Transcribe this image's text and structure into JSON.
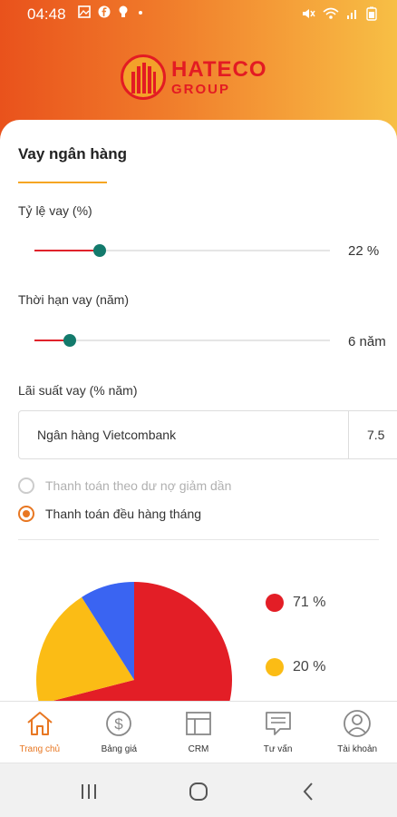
{
  "status_bar": {
    "time": "04:48",
    "left_icons": [
      "gallery-icon",
      "facebook-icon",
      "bulb-icon",
      "dot-icon"
    ],
    "right_icons": [
      "mute-icon",
      "wifi-icon",
      "signal-icon",
      "battery-icon"
    ]
  },
  "brand": {
    "name_line1": "HATECO",
    "name_line2": "GROUP",
    "color": "#e31b23"
  },
  "form": {
    "title": "Vay ngân hàng",
    "loan_ratio": {
      "label": "Tỷ lệ vay (%)",
      "value": "22 %",
      "level_fraction": 0.22
    },
    "loan_term": {
      "label": "Thời hạn vay (năm)",
      "value": "6 năm",
      "level_fraction": 0.12
    },
    "interest": {
      "label": "Lãi suất vay (% năm)",
      "bank_select": "Ngân hàng Vietcombank",
      "rate_value": "7.5"
    },
    "payment_options": [
      {
        "label": "Thanh toán theo dư nợ giảm dần",
        "selected": false
      },
      {
        "label": "Thanh toán đều hàng tháng",
        "selected": true
      }
    ]
  },
  "pie_chart": {
    "slices": [
      {
        "label": "71 %",
        "percent": 71,
        "color": "#e31e26"
      },
      {
        "label": "20 %",
        "percent": 20,
        "color": "#fbbc15"
      },
      {
        "label": "9 %",
        "percent": 9,
        "color": "#3a64f2"
      }
    ],
    "visible_legend": [
      "71 %",
      "20 %"
    ]
  },
  "bottom_nav": [
    {
      "label": "Trang chủ",
      "icon": "home-icon",
      "active": true
    },
    {
      "label": "Bảng giá",
      "icon": "dollar-icon",
      "active": false
    },
    {
      "label": "CRM",
      "icon": "crm-icon",
      "active": false
    },
    {
      "label": "Tư vấn",
      "icon": "chat-icon",
      "active": false
    },
    {
      "label": "Tài khoản",
      "icon": "account-icon",
      "active": false
    }
  ],
  "colors": {
    "accent": "#e87722",
    "slider_fill": "#e0222b",
    "slider_thumb": "#137a6c",
    "header_gradient_start": "#e9521c",
    "header_gradient_end": "#f7bf45"
  }
}
